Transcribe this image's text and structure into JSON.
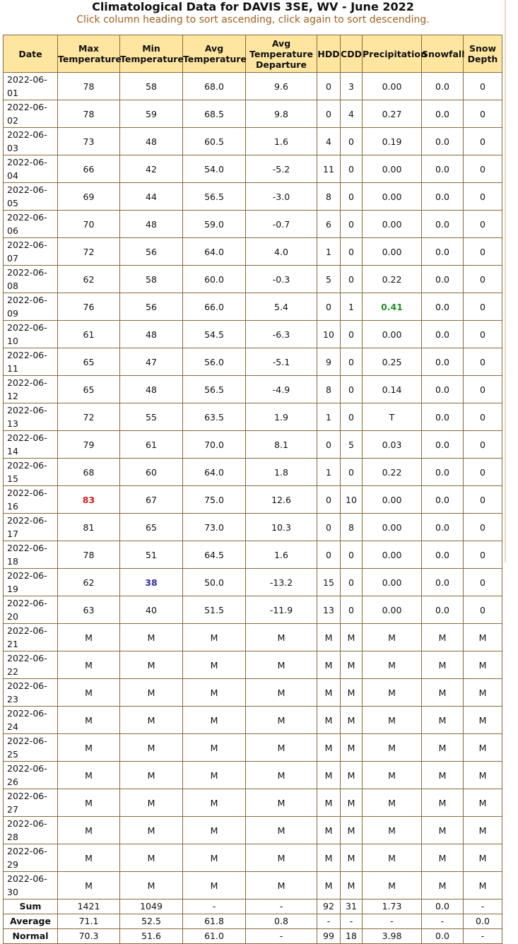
{
  "page": {
    "title": "Climatological Data for DAVIS 3SE, WV - June 2022",
    "subtitle": "Click column heading to sort ascending, click again to sort descending."
  },
  "table": {
    "headers": [
      [
        "Date"
      ],
      [
        "Max",
        "Temperature"
      ],
      [
        "Min",
        "Temperature"
      ],
      [
        "Avg",
        "Temperature"
      ],
      [
        "Avg",
        "Temperature",
        "Departure"
      ],
      [
        "HDD"
      ],
      [
        "CDD"
      ],
      [
        "Precipitation"
      ],
      [
        "Snowfall"
      ],
      [
        "Snow",
        "Depth"
      ]
    ],
    "highlight_colors": {
      "max_record": "#cc2222",
      "min_record": "#2a2aa8",
      "precip_record": "#22922a"
    },
    "rows": [
      [
        "2022-06-01",
        "78",
        "58",
        "68.0",
        "9.6",
        "0",
        "3",
        "0.00",
        "0.0",
        "0"
      ],
      [
        "2022-06-02",
        "78",
        "59",
        "68.5",
        "9.8",
        "0",
        "4",
        "0.27",
        "0.0",
        "0"
      ],
      [
        "2022-06-03",
        "73",
        "48",
        "60.5",
        "1.6",
        "4",
        "0",
        "0.19",
        "0.0",
        "0"
      ],
      [
        "2022-06-04",
        "66",
        "42",
        "54.0",
        "-5.2",
        "11",
        "0",
        "0.00",
        "0.0",
        "0"
      ],
      [
        "2022-06-05",
        "69",
        "44",
        "56.5",
        "-3.0",
        "8",
        "0",
        "0.00",
        "0.0",
        "0"
      ],
      [
        "2022-06-06",
        "70",
        "48",
        "59.0",
        "-0.7",
        "6",
        "0",
        "0.00",
        "0.0",
        "0"
      ],
      [
        "2022-06-07",
        "72",
        "56",
        "64.0",
        "4.0",
        "1",
        "0",
        "0.00",
        "0.0",
        "0"
      ],
      [
        "2022-06-08",
        "62",
        "58",
        "60.0",
        "-0.3",
        "5",
        "0",
        "0.22",
        "0.0",
        "0"
      ],
      [
        "2022-06-09",
        "76",
        "56",
        "66.0",
        "5.4",
        "0",
        "1",
        "0.41",
        "0.0",
        "0"
      ],
      [
        "2022-06-10",
        "61",
        "48",
        "54.5",
        "-6.3",
        "10",
        "0",
        "0.00",
        "0.0",
        "0"
      ],
      [
        "2022-06-11",
        "65",
        "47",
        "56.0",
        "-5.1",
        "9",
        "0",
        "0.25",
        "0.0",
        "0"
      ],
      [
        "2022-06-12",
        "65",
        "48",
        "56.5",
        "-4.9",
        "8",
        "0",
        "0.14",
        "0.0",
        "0"
      ],
      [
        "2022-06-13",
        "72",
        "55",
        "63.5",
        "1.9",
        "1",
        "0",
        "T",
        "0.0",
        "0"
      ],
      [
        "2022-06-14",
        "79",
        "61",
        "70.0",
        "8.1",
        "0",
        "5",
        "0.03",
        "0.0",
        "0"
      ],
      [
        "2022-06-15",
        "68",
        "60",
        "64.0",
        "1.8",
        "1",
        "0",
        "0.22",
        "0.0",
        "0"
      ],
      [
        "2022-06-16",
        "83",
        "67",
        "75.0",
        "12.6",
        "0",
        "10",
        "0.00",
        "0.0",
        "0"
      ],
      [
        "2022-06-17",
        "81",
        "65",
        "73.0",
        "10.3",
        "0",
        "8",
        "0.00",
        "0.0",
        "0"
      ],
      [
        "2022-06-18",
        "78",
        "51",
        "64.5",
        "1.6",
        "0",
        "0",
        "0.00",
        "0.0",
        "0"
      ],
      [
        "2022-06-19",
        "62",
        "38",
        "50.0",
        "-13.2",
        "15",
        "0",
        "0.00",
        "0.0",
        "0"
      ],
      [
        "2022-06-20",
        "63",
        "40",
        "51.5",
        "-11.9",
        "13",
        "0",
        "0.00",
        "0.0",
        "0"
      ],
      [
        "2022-06-21",
        "M",
        "M",
        "M",
        "M",
        "M",
        "M",
        "M",
        "M",
        "M"
      ],
      [
        "2022-06-22",
        "M",
        "M",
        "M",
        "M",
        "M",
        "M",
        "M",
        "M",
        "M"
      ],
      [
        "2022-06-23",
        "M",
        "M",
        "M",
        "M",
        "M",
        "M",
        "M",
        "M",
        "M"
      ],
      [
        "2022-06-24",
        "M",
        "M",
        "M",
        "M",
        "M",
        "M",
        "M",
        "M",
        "M"
      ],
      [
        "2022-06-25",
        "M",
        "M",
        "M",
        "M",
        "M",
        "M",
        "M",
        "M",
        "M"
      ],
      [
        "2022-06-26",
        "M",
        "M",
        "M",
        "M",
        "M",
        "M",
        "M",
        "M",
        "M"
      ],
      [
        "2022-06-27",
        "M",
        "M",
        "M",
        "M",
        "M",
        "M",
        "M",
        "M",
        "M"
      ],
      [
        "2022-06-28",
        "M",
        "M",
        "M",
        "M",
        "M",
        "M",
        "M",
        "M",
        "M"
      ],
      [
        "2022-06-29",
        "M",
        "M",
        "M",
        "M",
        "M",
        "M",
        "M",
        "M",
        "M"
      ],
      [
        "2022-06-30",
        "M",
        "M",
        "M",
        "M",
        "M",
        "M",
        "M",
        "M",
        "M"
      ]
    ],
    "highlighted_cells": [
      {
        "row": 15,
        "col": 1,
        "kind": "max_record"
      },
      {
        "row": 18,
        "col": 2,
        "kind": "min_record"
      },
      {
        "row": 8,
        "col": 7,
        "kind": "precip_record"
      }
    ],
    "summary": [
      [
        "Sum",
        "1421",
        "1049",
        "-",
        "-",
        "92",
        "31",
        "1.73",
        "0.0",
        "-"
      ],
      [
        "Average",
        "71.1",
        "52.5",
        "61.8",
        "0.8",
        "-",
        "-",
        "-",
        "-",
        "0.0"
      ],
      [
        "Normal",
        "70.3",
        "51.6",
        "61.0",
        "-",
        "99",
        "18",
        "3.98",
        "0.0",
        "-"
      ]
    ]
  }
}
